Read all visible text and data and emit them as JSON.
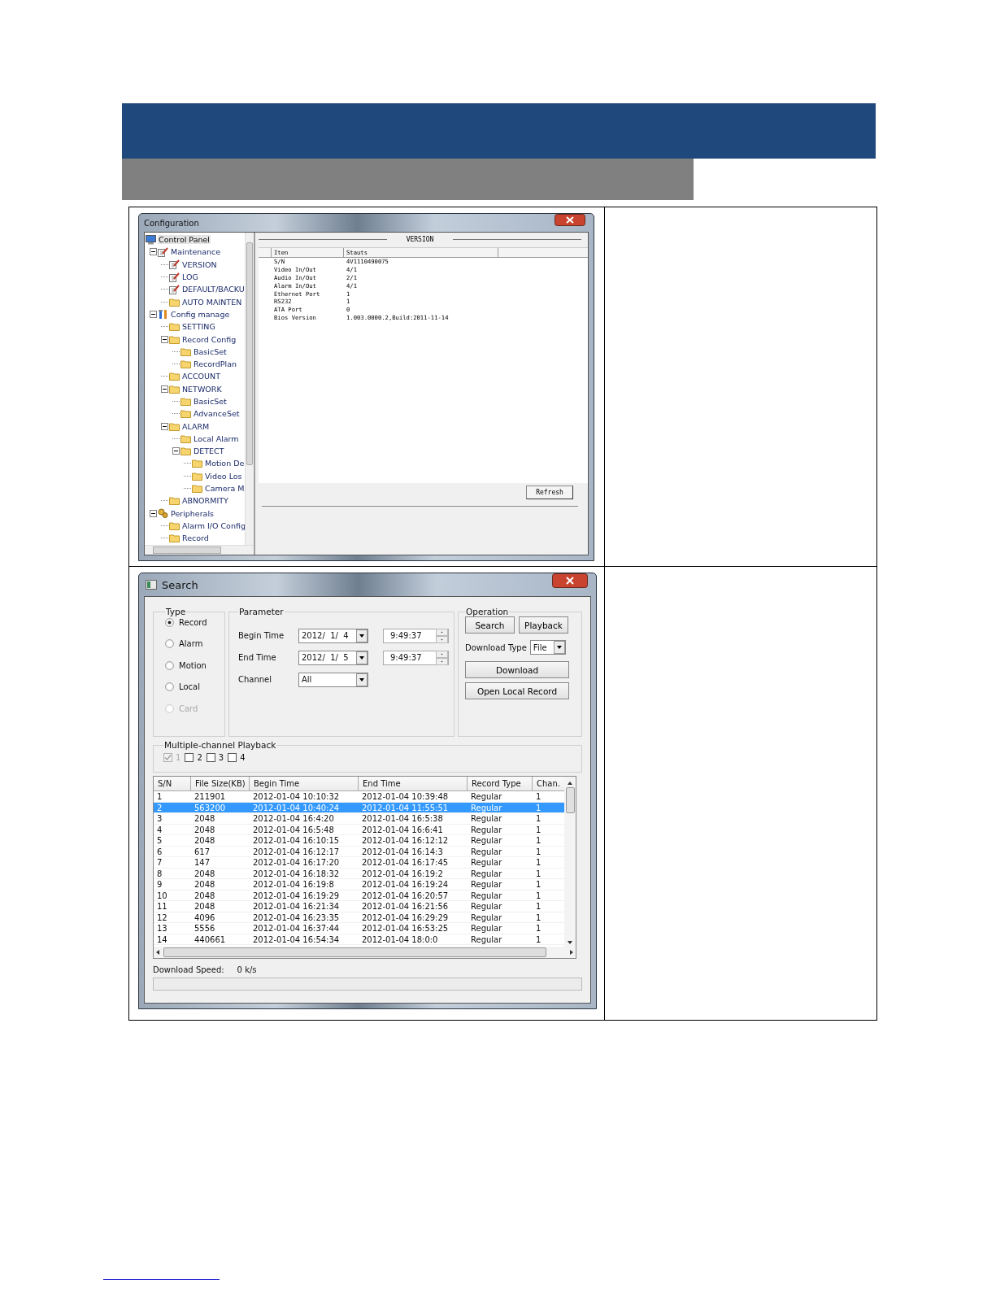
{
  "config_window": {
    "title": "Configuration",
    "tree": [
      {
        "label": "Control Panel",
        "kind": "computer",
        "selected": true,
        "children": [
          {
            "label": "Maintenance",
            "kind": "edit",
            "selected": false,
            "expanded": true,
            "children": [
              {
                "label": "VERSION",
                "kind": "edit",
                "selected": false
              },
              {
                "label": "LOG",
                "kind": "edit",
                "selected": false
              },
              {
                "label": "DEFAULT/BACKU",
                "kind": "edit",
                "selected": false
              },
              {
                "label": "AUTO MAINTEN",
                "kind": "folder",
                "selected": false
              }
            ]
          },
          {
            "label": "Config manage",
            "kind": "tools",
            "selected": false,
            "expanded": true,
            "children": [
              {
                "label": "SETTING",
                "kind": "folder",
                "selected": false
              },
              {
                "label": "Record Config",
                "kind": "folder",
                "selected": false,
                "expanded": true,
                "children": [
                  {
                    "label": "BasicSet",
                    "kind": "folder",
                    "selected": false
                  },
                  {
                    "label": "RecordPlan",
                    "kind": "folder",
                    "selected": false
                  }
                ]
              },
              {
                "label": "ACCOUNT",
                "kind": "folder",
                "selected": false
              },
              {
                "label": "NETWORK",
                "kind": "folder",
                "selected": false,
                "expanded": true,
                "children": [
                  {
                    "label": "BasicSet",
                    "kind": "folder",
                    "selected": false
                  },
                  {
                    "label": "AdvanceSet",
                    "kind": "folder",
                    "selected": false
                  }
                ]
              },
              {
                "label": "ALARM",
                "kind": "folder",
                "selected": false,
                "expanded": true,
                "children": [
                  {
                    "label": "Local Alarm",
                    "kind": "folder",
                    "selected": false
                  },
                  {
                    "label": "DETECT",
                    "kind": "folder",
                    "selected": false,
                    "expanded": true,
                    "children": [
                      {
                        "label": "Motion De",
                        "kind": "folder",
                        "selected": false
                      },
                      {
                        "label": "Video Los",
                        "kind": "folder",
                        "selected": false
                      },
                      {
                        "label": "Camera M",
                        "kind": "folder",
                        "selected": false
                      }
                    ]
                  }
                ]
              },
              {
                "label": "ABNORMITY",
                "kind": "folder",
                "selected": false
              }
            ]
          },
          {
            "label": "Peripherals",
            "kind": "gears",
            "selected": false,
            "expanded": true,
            "children": [
              {
                "label": "Alarm I/O Config",
                "kind": "folder",
                "selected": false
              },
              {
                "label": "Record",
                "kind": "folder",
                "selected": false
              }
            ]
          }
        ]
      }
    ],
    "version": {
      "title": "VERSION",
      "columns": [
        "Iten",
        "Stauts"
      ],
      "rows": [
        [
          "S/N",
          "4V1110490075"
        ],
        [
          "Video In/Out",
          "4/1"
        ],
        [
          "Audio In/Out",
          "2/1"
        ],
        [
          "Alarm In/Out",
          "4/1"
        ],
        [
          "Ethernet Port",
          "1"
        ],
        [
          "RS232",
          "1"
        ],
        [
          "ATA Port",
          "0"
        ],
        [
          "Bios Version",
          "1.003.0000.2,Build:2011-11-14"
        ]
      ],
      "refresh_button": "Refresh"
    }
  },
  "search_window": {
    "title": "Search",
    "type_group": {
      "label": "Type",
      "options": [
        {
          "label": "Record",
          "selected": true,
          "disabled": false
        },
        {
          "label": "Alarm",
          "selected": false,
          "disabled": false
        },
        {
          "label": "Motion",
          "selected": false,
          "disabled": false
        },
        {
          "label": "Local",
          "selected": false,
          "disabled": false
        },
        {
          "label": "Card",
          "selected": false,
          "disabled": true
        }
      ]
    },
    "parameter_group": {
      "label": "Parameter",
      "begin_time": {
        "label": "Begin Time",
        "date": "2012/  1/  4",
        "time": "9:49:37"
      },
      "end_time": {
        "label": "End Time",
        "date": "2012/  1/  5",
        "time": "9:49:37"
      },
      "channel": {
        "label": "Channel",
        "value": "All"
      }
    },
    "operation_group": {
      "label": "Operation",
      "search_button": "Search",
      "playback_button": "Playback",
      "download_type_label": "Download Type",
      "download_type_value": "File",
      "download_button": "Download",
      "open_local_button": "Open Local Record"
    },
    "multi_channel": {
      "label": "Multiple-channel Playback",
      "channels": [
        {
          "label": "1",
          "checked": true,
          "disabled": true
        },
        {
          "label": "2",
          "checked": false,
          "disabled": false
        },
        {
          "label": "3",
          "checked": false,
          "disabled": false
        },
        {
          "label": "4",
          "checked": false,
          "disabled": false
        }
      ]
    },
    "records": {
      "columns": [
        "S/N",
        "File Size(KB)",
        "Begin Time",
        "End Time",
        "Record Type",
        "Chan."
      ],
      "rows": [
        {
          "cells": [
            "1",
            "211901",
            "2012-01-04 10:10:32",
            "2012-01-04 10:39:48",
            "Regular",
            "1"
          ],
          "selected": false
        },
        {
          "cells": [
            "2",
            "563200",
            "2012-01-04 10:40:24",
            "2012-01-04 11:55:51",
            "Regular",
            "1"
          ],
          "selected": true
        },
        {
          "cells": [
            "3",
            "2048",
            "2012-01-04 16:4:20",
            "2012-01-04 16:5:38",
            "Regular",
            "1"
          ],
          "selected": false
        },
        {
          "cells": [
            "4",
            "2048",
            "2012-01-04 16:5:48",
            "2012-01-04 16:6:41",
            "Regular",
            "1"
          ],
          "selected": false
        },
        {
          "cells": [
            "5",
            "2048",
            "2012-01-04 16:10:15",
            "2012-01-04 16:12:12",
            "Regular",
            "1"
          ],
          "selected": false
        },
        {
          "cells": [
            "6",
            "617",
            "2012-01-04 16:12:17",
            "2012-01-04 16:14:3",
            "Regular",
            "1"
          ],
          "selected": false
        },
        {
          "cells": [
            "7",
            "147",
            "2012-01-04 16:17:20",
            "2012-01-04 16:17:45",
            "Regular",
            "1"
          ],
          "selected": false
        },
        {
          "cells": [
            "8",
            "2048",
            "2012-01-04 16:18:32",
            "2012-01-04 16:19:2",
            "Regular",
            "1"
          ],
          "selected": false
        },
        {
          "cells": [
            "9",
            "2048",
            "2012-01-04 16:19:8",
            "2012-01-04 16:19:24",
            "Regular",
            "1"
          ],
          "selected": false
        },
        {
          "cells": [
            "10",
            "2048",
            "2012-01-04 16:19:29",
            "2012-01-04 16:20:57",
            "Regular",
            "1"
          ],
          "selected": false
        },
        {
          "cells": [
            "11",
            "2048",
            "2012-01-04 16:21:34",
            "2012-01-04 16:21:56",
            "Regular",
            "1"
          ],
          "selected": false
        },
        {
          "cells": [
            "12",
            "4096",
            "2012-01-04 16:23:35",
            "2012-01-04 16:29:29",
            "Regular",
            "1"
          ],
          "selected": false
        },
        {
          "cells": [
            "13",
            "5556",
            "2012-01-04 16:37:44",
            "2012-01-04 16:53:25",
            "Regular",
            "1"
          ],
          "selected": false
        },
        {
          "cells": [
            "14",
            "440661",
            "2012-01-04 16:54:34",
            "2012-01-04 18:0:0",
            "Regular",
            "1"
          ],
          "selected": false
        }
      ]
    },
    "download_speed": {
      "label": "Download Speed:",
      "value": "0 k/s"
    },
    "progress": {
      "level": 0
    }
  }
}
